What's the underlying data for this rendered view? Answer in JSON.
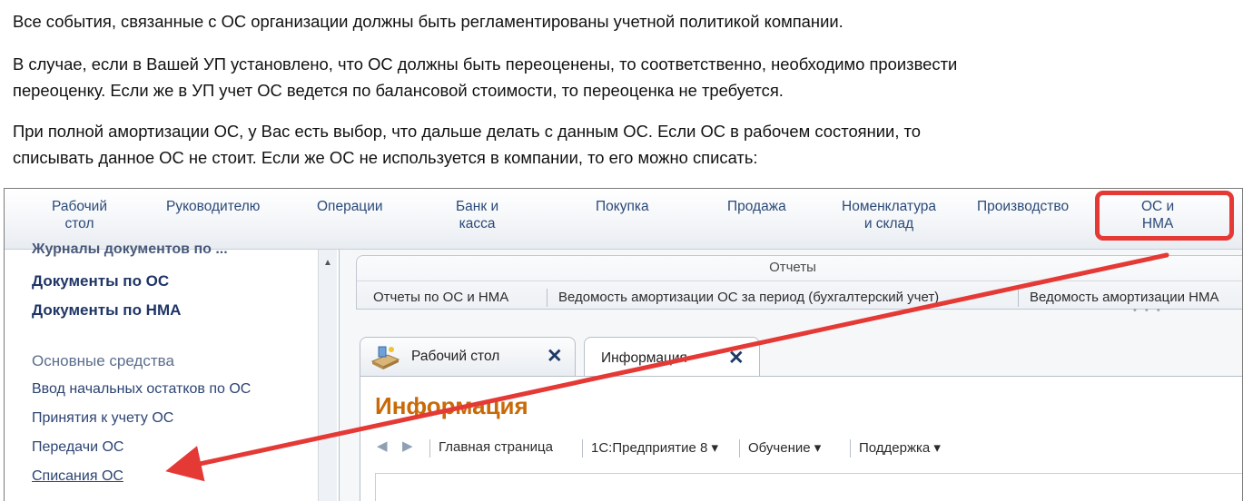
{
  "article": {
    "p1": "Все события, связанные с ОС организации должны быть регламентированы учетной политикой компании.",
    "p2_line1": "В случае, если в Вашей УП установлено, что ОС должны быть переоценены, то соответственно, необходимо произвести",
    "p2_line2": "переоценку. Если же в УП учет ОС ведется по балансовой стоимости, то переоценка не требуется.",
    "p3_line1": "При полной амортизации ОС, у Вас есть выбор, что дальше делать с данным ОС. Если ОС в рабочем состоянии, то",
    "p3_line2": "списывать данное ОС не стоит. Если же ОС не используется в компании, то его можно списать:"
  },
  "app": {
    "top_menu": [
      {
        "label": "Рабочий\nстол"
      },
      {
        "label": "Руководителю"
      },
      {
        "label": "Операции"
      },
      {
        "label": "Банк и\nкасса"
      },
      {
        "label": "Покупка"
      },
      {
        "label": "Продажа"
      },
      {
        "label": "Номенклатура\nи склад"
      },
      {
        "label": "Производство"
      },
      {
        "label": "ОС и\nНМА"
      }
    ],
    "left_panel": {
      "cut_heading": "Журналы документов по ...",
      "items_bold": [
        "Документы по ОС",
        "Документы по НМА"
      ],
      "section_title": "Основные средства",
      "items": [
        "Ввод начальных остатков по ОС",
        "Принятия к учету ОС",
        "Передачи ОС",
        "Списания ОС"
      ]
    },
    "reports": {
      "title": "Отчеты",
      "links": [
        "Отчеты по ОС и НМА",
        "Ведомость амортизации ОС за период (бухгалтерский учет)",
        "Ведомость амортизации НМА"
      ]
    },
    "tabs": [
      {
        "label": "Рабочий стол",
        "close": "✕",
        "icon": "desktop-icon"
      },
      {
        "label": "Информация",
        "close": "✕"
      }
    ],
    "content": {
      "heading": "Информация",
      "nav": {
        "back": "◀",
        "forward": "▶",
        "links": [
          "Главная страница",
          "1С:Предприятие 8 ▾",
          "Обучение ▾",
          "Поддержка ▾"
        ]
      }
    },
    "annotation_color": "#e53935"
  }
}
